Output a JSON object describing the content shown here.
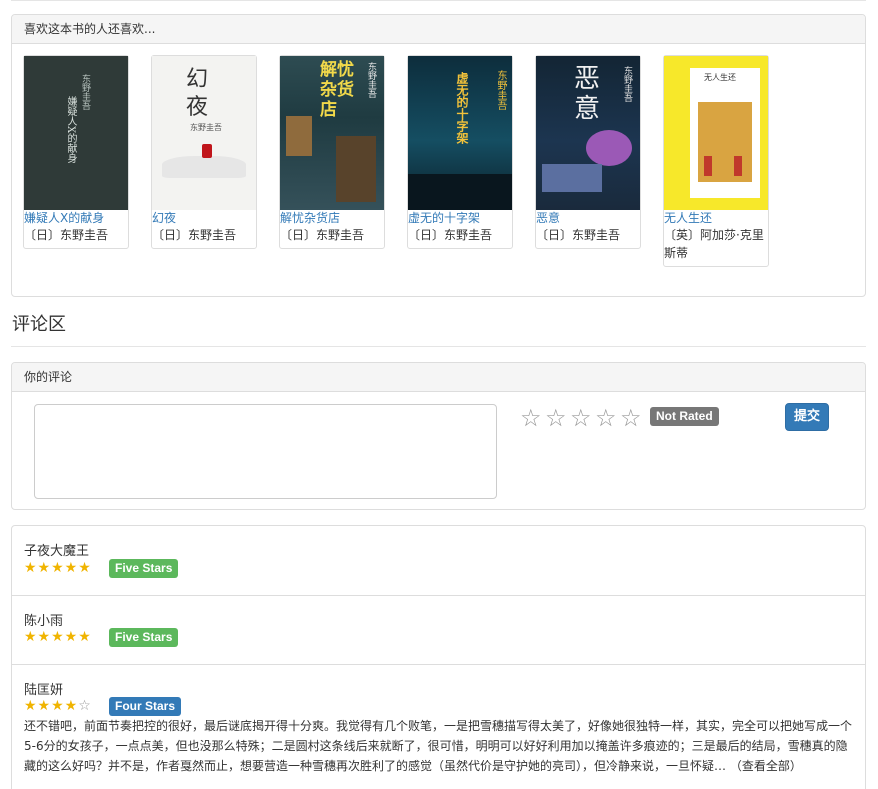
{
  "recommend": {
    "heading": "喜欢这本书的人还喜欢...",
    "books": [
      {
        "title": "嫌疑人X的献身",
        "author": "〔日〕东野圭吾",
        "cover_text": "嫌疑人X的献身",
        "cover_author": "东野圭吾"
      },
      {
        "title": "幻夜",
        "author": "〔日〕东野圭吾",
        "cover_text": "幻夜",
        "cover_author": "东野圭吾"
      },
      {
        "title": "解忧杂货店",
        "author": "〔日〕东野圭吾",
        "cover_text": "解忧杂货店",
        "cover_author": "东野圭吾"
      },
      {
        "title": "虚无的十字架",
        "author": "〔日〕东野圭吾",
        "cover_text": "虚无的十字架",
        "cover_author": "东野圭吾"
      },
      {
        "title": "恶意",
        "author": "〔日〕东野圭吾",
        "cover_text": "恶意",
        "cover_author": "东野圭吾"
      },
      {
        "title": "无人生还",
        "author": "〔英〕阿加莎·克里斯蒂",
        "cover_text": "无人生还",
        "cover_author": ""
      }
    ]
  },
  "comments": {
    "title": "评论区",
    "your_review": {
      "heading": "你的评论",
      "textarea_value": "",
      "rating_label": "Not Rated",
      "submit_label": "提交"
    },
    "reviews": [
      {
        "name": "子夜大魔王",
        "rating": 5,
        "badge": "Five Stars",
        "text": ""
      },
      {
        "name": "陈小雨",
        "rating": 5,
        "badge": "Five Stars",
        "text": ""
      },
      {
        "name": "陆匡妍",
        "rating": 4,
        "badge": "Four Stars",
        "text": "还不错吧，前面节奏把控的很好，最后谜底揭开得十分爽。我觉得有几个败笔，一是把雪穗描写得太美了，好像她很独特一样，其实，完全可以把她写成一个5-6分的女孩子，一点点美，但也没那么特殊；二是圆村这条线后来就断了，很可惜，明明可以好好利用加以掩盖许多痕迹的；三是最后的结局，雪穗真的隐藏的这么好吗？并不是，作者戛然而止，想要营造一种雪穗再次胜利了的感觉（虽然代价是守护她的亮司），但冷静来说，一旦怀疑… （查看全部）"
      }
    ]
  },
  "colors": {
    "link": "#337ab7",
    "success": "#5cb85c",
    "primary": "#337ab7",
    "default_badge": "#777777",
    "star": "#f0b400"
  }
}
